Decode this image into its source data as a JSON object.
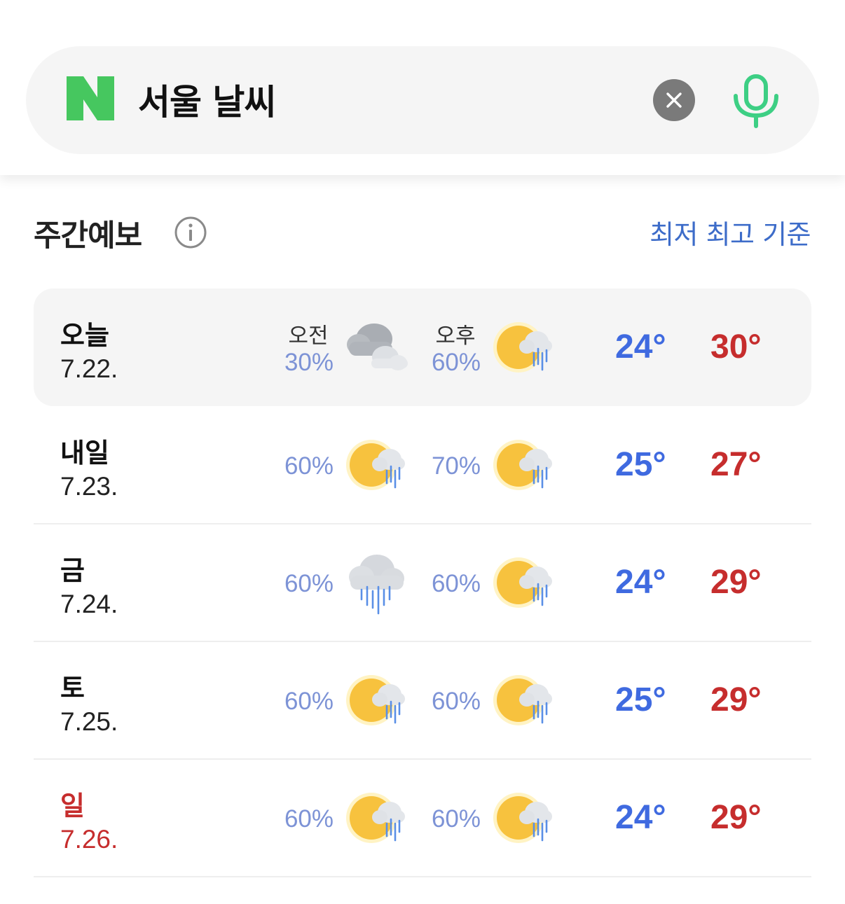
{
  "search": {
    "query": "서울 날씨",
    "logo_text": "N"
  },
  "forecast": {
    "title": "주간예보",
    "sort_label": "최저 최고 기준",
    "am_label": "오전",
    "pm_label": "오후",
    "days": [
      {
        "name": "오늘",
        "date": "7.22.",
        "am_rain": "30%",
        "am_icon": "cloudy-icon",
        "pm_rain": "60%",
        "pm_icon": "sun-rain-icon",
        "min": "24°",
        "max": "30°"
      },
      {
        "name": "내일",
        "date": "7.23.",
        "am_rain": "60%",
        "am_icon": "sun-rain-icon",
        "pm_rain": "70%",
        "pm_icon": "sun-rain-icon",
        "min": "25°",
        "max": "27°"
      },
      {
        "name": "금",
        "date": "7.24.",
        "am_rain": "60%",
        "am_icon": "rain-cloud-icon",
        "pm_rain": "60%",
        "pm_icon": "sun-rain-icon",
        "min": "24°",
        "max": "29°"
      },
      {
        "name": "토",
        "date": "7.25.",
        "am_rain": "60%",
        "am_icon": "sun-rain-icon",
        "pm_rain": "60%",
        "pm_icon": "sun-rain-icon",
        "min": "25°",
        "max": "29°"
      },
      {
        "name": "일",
        "date": "7.26.",
        "am_rain": "60%",
        "am_icon": "sun-rain-icon",
        "pm_rain": "60%",
        "pm_icon": "sun-rain-icon",
        "min": "24°",
        "max": "29°"
      }
    ]
  },
  "colors": {
    "naver_green": "#03c75a",
    "min_temp": "#3f6ae0",
    "max_temp": "#c62d2d",
    "rain_prob": "#7d93d6",
    "link": "#3d6cc9",
    "sunday": "#c62d2d"
  }
}
